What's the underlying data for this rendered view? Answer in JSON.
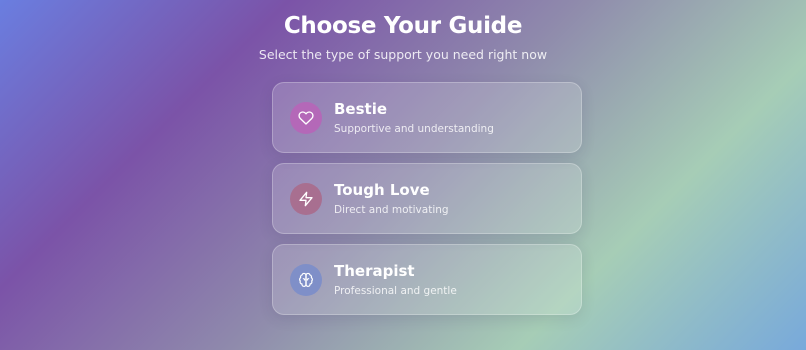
{
  "header": {
    "title": "Choose Your Guide",
    "subtitle": "Select the type of support you need right now"
  },
  "guides": [
    {
      "title": "Bestie",
      "description": "Supportive and understanding",
      "icon": "heart-icon",
      "icon_bg": "#b468b8"
    },
    {
      "title": "Tough Love",
      "description": "Direct and motivating",
      "icon": "lightning-icon",
      "icon_bg": "#a86f90"
    },
    {
      "title": "Therapist",
      "description": "Professional and gentle",
      "icon": "brain-icon",
      "icon_bg": "#7f8fc8"
    }
  ]
}
